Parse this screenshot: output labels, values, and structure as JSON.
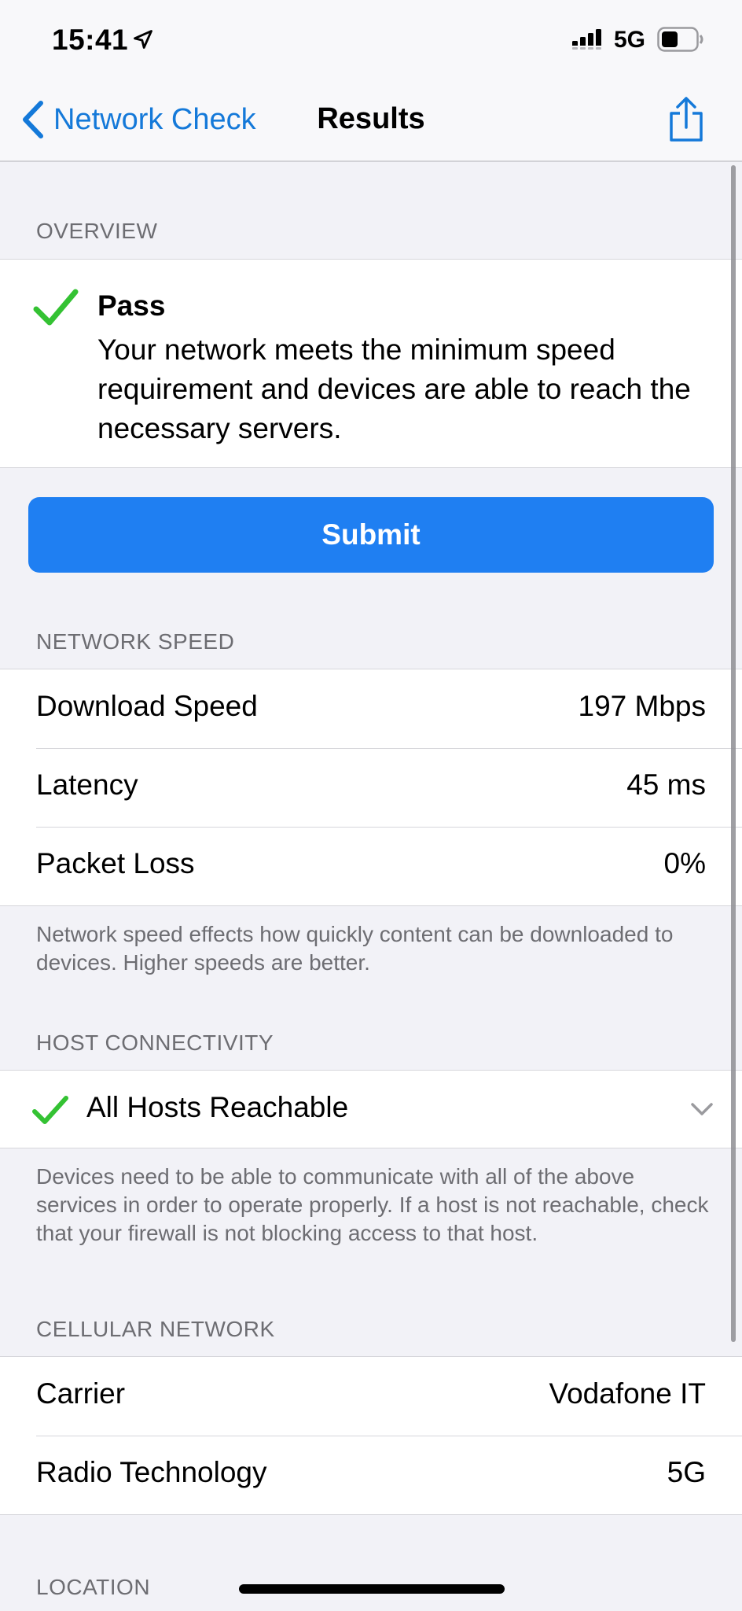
{
  "status_bar": {
    "time": "15:41",
    "network": "5G"
  },
  "nav": {
    "back_label": "Network Check",
    "title": "Results"
  },
  "overview": {
    "header": "OVERVIEW",
    "result_title": "Pass",
    "result_text": "Your network meets the minimum speed requirement and devices are able to reach the necessary servers."
  },
  "submit_label": "Submit",
  "network_speed": {
    "header": "NETWORK SPEED",
    "rows": [
      {
        "label": "Download Speed",
        "value": "197 Mbps"
      },
      {
        "label": "Latency",
        "value": "45 ms"
      },
      {
        "label": "Packet Loss",
        "value": "0%"
      }
    ],
    "footer": "Network speed effects how quickly content can be downloaded to devices. Higher speeds are better."
  },
  "host_connectivity": {
    "header": "HOST CONNECTIVITY",
    "row_label": "All Hosts Reachable",
    "footer": "Devices need to be able to communicate with all of the above services in order to operate properly. If a host is not reachable, check that your firewall is not blocking access to that host."
  },
  "cellular": {
    "header": "CELLULAR NETWORK",
    "rows": [
      {
        "label": "Carrier",
        "value": "Vodafone IT"
      },
      {
        "label": "Radio Technology",
        "value": "5G"
      }
    ]
  },
  "location": {
    "header": "LOCATION"
  },
  "colors": {
    "accent": "#1479d9",
    "submit": "#1f7ff2",
    "check": "#34c233"
  }
}
